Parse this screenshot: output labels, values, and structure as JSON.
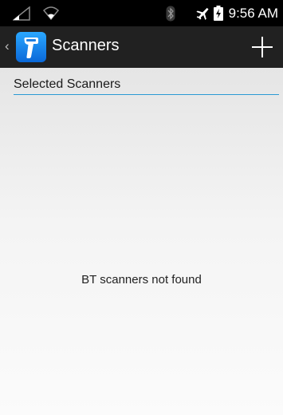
{
  "status_bar": {
    "time": "9:56 AM",
    "icons": [
      "signal-icon",
      "wifi-icon",
      "bluetooth-icon",
      "airplane-mode-icon",
      "battery-charging-icon"
    ]
  },
  "action_bar": {
    "title": "Scanners",
    "app_icon": "scanner-icon",
    "action_icon": "plus-icon",
    "up_indicator": "‹"
  },
  "content": {
    "section_header": "Selected Scanners",
    "empty_message": "BT scanners not found"
  },
  "colors": {
    "status_bar_bg": "#000000",
    "action_bar_bg": "#212121",
    "accent": "#2b9ad4",
    "app_icon_blue": "#1e90ff"
  }
}
